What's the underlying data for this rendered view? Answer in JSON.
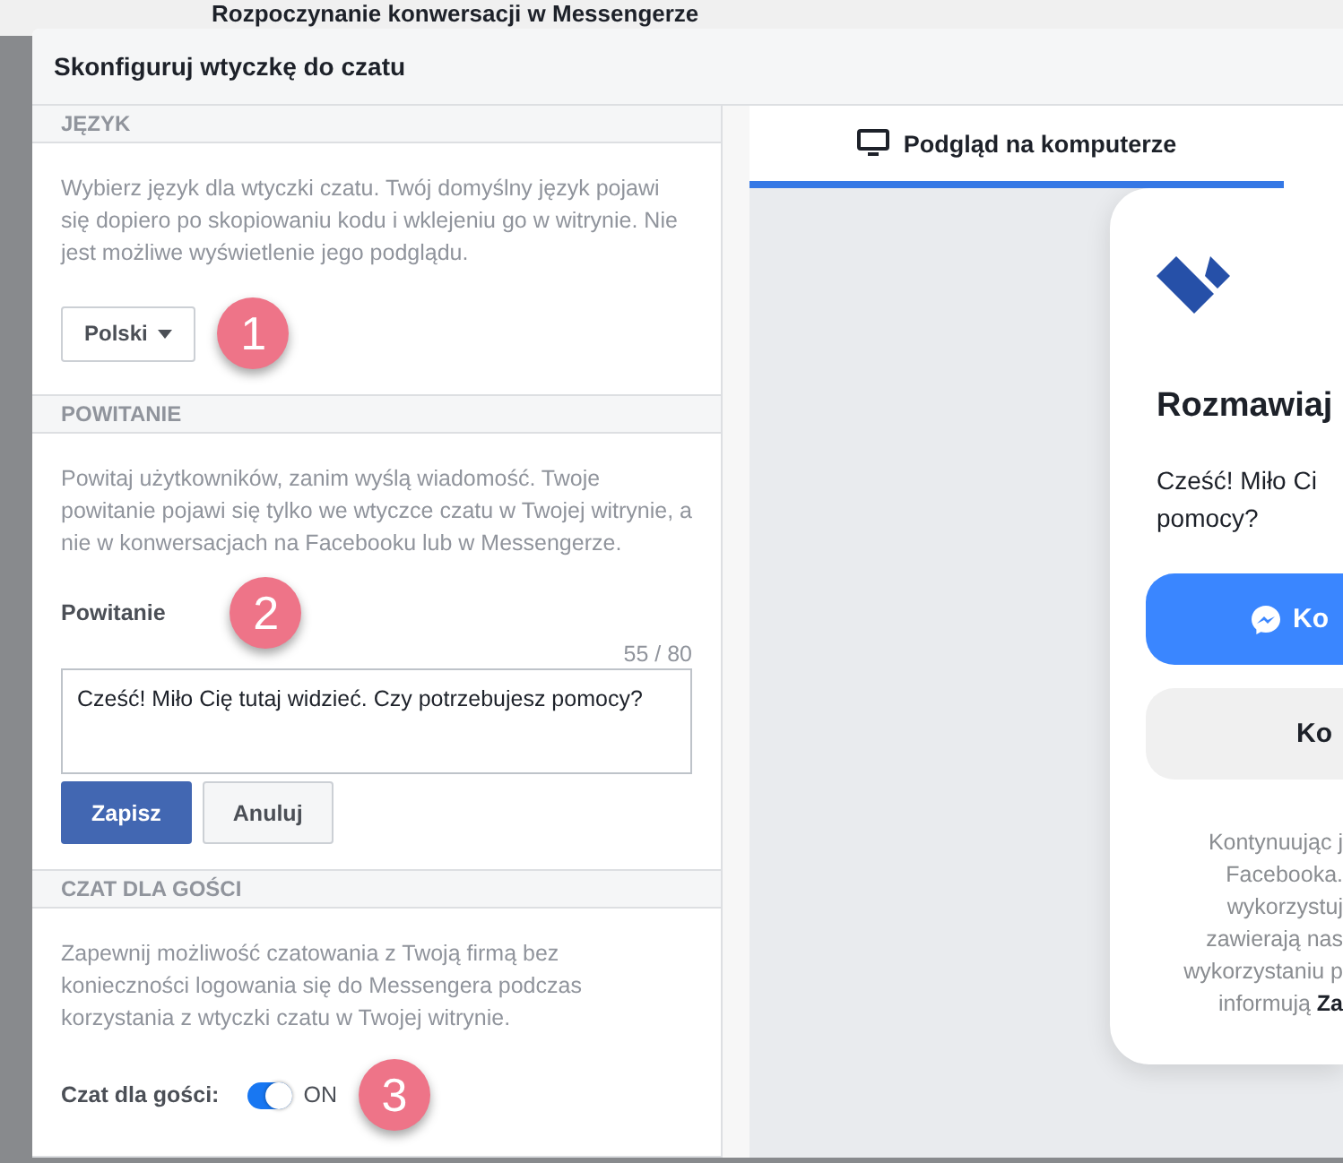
{
  "background_page": {
    "title": "Rozpoczynanie konwersacji w Messengerze"
  },
  "dialog": {
    "title": "Skonfiguruj wtyczkę do czatu"
  },
  "sections": [
    {
      "heading": "JĘZYK",
      "description": "Wybierz język dla wtyczki czatu. Twój domyślny język pojawi się dopiero po skopiowaniu kodu i wklejeniu go w witrynie. Nie jest możliwe wyświetlenie jego podglądu.",
      "kind": "dropdown",
      "dropdown": {
        "value": "Polski"
      },
      "badge": "1"
    },
    {
      "heading": "POWITANIE",
      "description": "Powitaj użytkowników, zanim wyślą wiadomość. Twoje powitanie pojawi się tylko we wtyczce czatu w Twojej witrynie, a nie w konwersacjach na Facebooku lub w Messengerze.",
      "kind": "greeting",
      "label": "Powitanie",
      "counter": "55 / 80",
      "value": "Cześć! Miło Cię tutaj widzieć. Czy potrzebujesz pomocy?",
      "buttons": [
        {
          "label": "Zapisz",
          "kind": "primary"
        },
        {
          "label": "Anuluj",
          "kind": "secondary"
        }
      ],
      "badge": "2"
    },
    {
      "heading": "CZAT DLA GOŚCI",
      "description": "Zapewnij możliwość czatowania z Twoją firmą bez konieczności logowania się do Messengera podczas korzystania z wtyczki czatu w Twojej witrynie.",
      "kind": "toggle",
      "label": "Czat dla gości:",
      "on": true,
      "state_text": "ON",
      "badge": "3"
    }
  ],
  "preview": {
    "tabs": [
      {
        "label": "Podgląd na komputerze",
        "selected": true
      }
    ],
    "card": {
      "title": "Rozmawiaj",
      "greeting_lines": [
        "Cześć! Miło Ci",
        "pomocy?"
      ],
      "messenger_button": "Ko",
      "guest_button": "Ko",
      "footer_lines": [
        "Kontynuując j",
        "Facebooka.",
        "wykorzystuj",
        "zawierają nas",
        "wykorzystaniu p",
        "informują **Za**"
      ]
    }
  }
}
